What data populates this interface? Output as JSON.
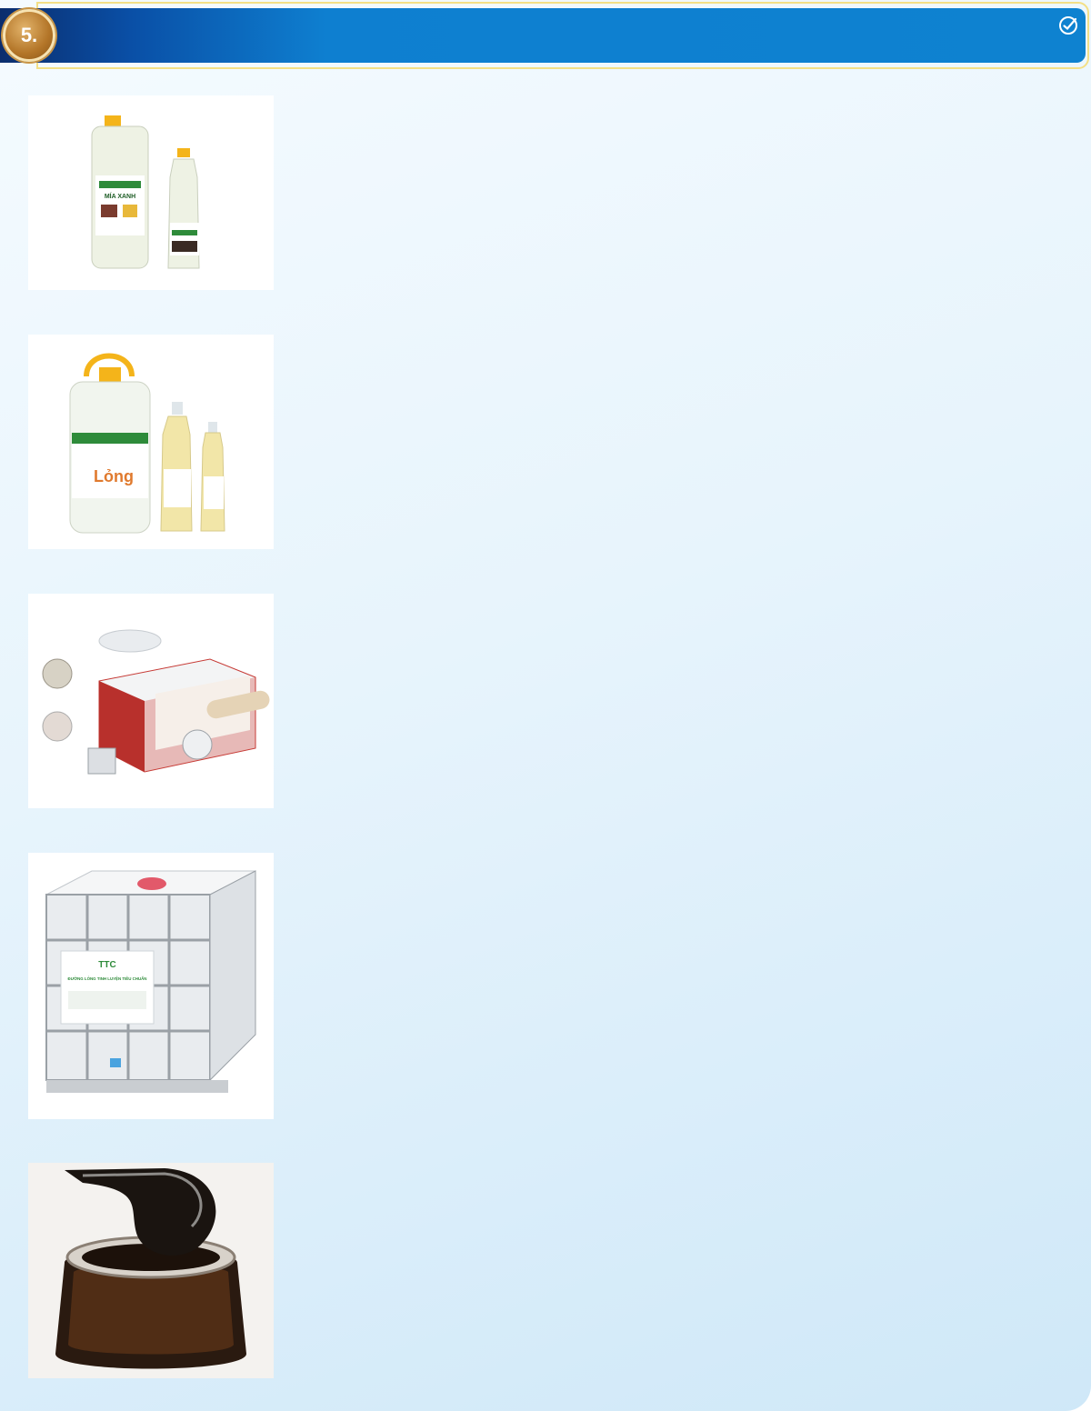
{
  "header": {
    "number": "5.",
    "check_icon": "check-circle-icon",
    "bar_color": "#0e82d0",
    "badge_color": "#b37528"
  },
  "product_images": [
    {
      "name": "bottles-mia-xanh",
      "label_text": "MÍA XANH"
    },
    {
      "name": "bottles-duong-long",
      "label_text": "Lỏng"
    },
    {
      "name": "container-flexitank"
    },
    {
      "name": "ibc-tank",
      "label_text": "ĐƯỜNG LỎNG TINH LUYỆN TIÊU CHUẨN"
    },
    {
      "name": "molasses-jar"
    }
  ]
}
